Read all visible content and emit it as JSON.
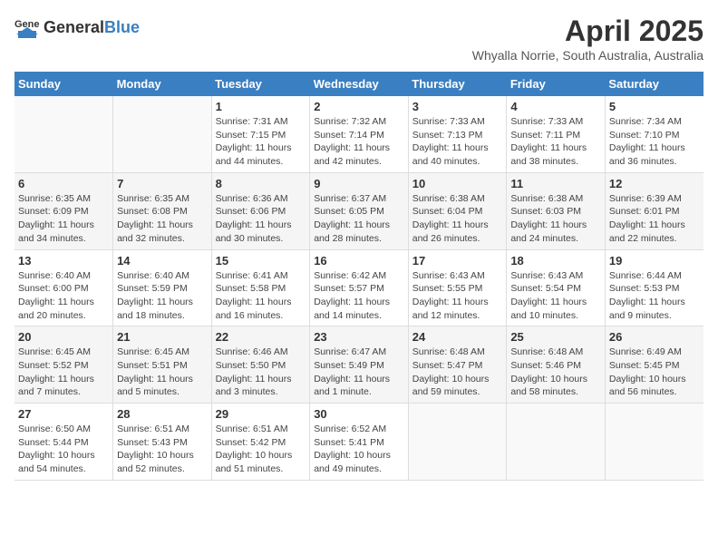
{
  "logo": {
    "text_general": "General",
    "text_blue": "Blue"
  },
  "title": "April 2025",
  "subtitle": "Whyalla Norrie, South Australia, Australia",
  "days_of_week": [
    "Sunday",
    "Monday",
    "Tuesday",
    "Wednesday",
    "Thursday",
    "Friday",
    "Saturday"
  ],
  "weeks": [
    [
      {
        "day": "",
        "sunrise": "",
        "sunset": "",
        "daylight": ""
      },
      {
        "day": "",
        "sunrise": "",
        "sunset": "",
        "daylight": ""
      },
      {
        "day": "1",
        "sunrise": "Sunrise: 7:31 AM",
        "sunset": "Sunset: 7:15 PM",
        "daylight": "Daylight: 11 hours and 44 minutes."
      },
      {
        "day": "2",
        "sunrise": "Sunrise: 7:32 AM",
        "sunset": "Sunset: 7:14 PM",
        "daylight": "Daylight: 11 hours and 42 minutes."
      },
      {
        "day": "3",
        "sunrise": "Sunrise: 7:33 AM",
        "sunset": "Sunset: 7:13 PM",
        "daylight": "Daylight: 11 hours and 40 minutes."
      },
      {
        "day": "4",
        "sunrise": "Sunrise: 7:33 AM",
        "sunset": "Sunset: 7:11 PM",
        "daylight": "Daylight: 11 hours and 38 minutes."
      },
      {
        "day": "5",
        "sunrise": "Sunrise: 7:34 AM",
        "sunset": "Sunset: 7:10 PM",
        "daylight": "Daylight: 11 hours and 36 minutes."
      }
    ],
    [
      {
        "day": "6",
        "sunrise": "Sunrise: 6:35 AM",
        "sunset": "Sunset: 6:09 PM",
        "daylight": "Daylight: 11 hours and 34 minutes."
      },
      {
        "day": "7",
        "sunrise": "Sunrise: 6:35 AM",
        "sunset": "Sunset: 6:08 PM",
        "daylight": "Daylight: 11 hours and 32 minutes."
      },
      {
        "day": "8",
        "sunrise": "Sunrise: 6:36 AM",
        "sunset": "Sunset: 6:06 PM",
        "daylight": "Daylight: 11 hours and 30 minutes."
      },
      {
        "day": "9",
        "sunrise": "Sunrise: 6:37 AM",
        "sunset": "Sunset: 6:05 PM",
        "daylight": "Daylight: 11 hours and 28 minutes."
      },
      {
        "day": "10",
        "sunrise": "Sunrise: 6:38 AM",
        "sunset": "Sunset: 6:04 PM",
        "daylight": "Daylight: 11 hours and 26 minutes."
      },
      {
        "day": "11",
        "sunrise": "Sunrise: 6:38 AM",
        "sunset": "Sunset: 6:03 PM",
        "daylight": "Daylight: 11 hours and 24 minutes."
      },
      {
        "day": "12",
        "sunrise": "Sunrise: 6:39 AM",
        "sunset": "Sunset: 6:01 PM",
        "daylight": "Daylight: 11 hours and 22 minutes."
      }
    ],
    [
      {
        "day": "13",
        "sunrise": "Sunrise: 6:40 AM",
        "sunset": "Sunset: 6:00 PM",
        "daylight": "Daylight: 11 hours and 20 minutes."
      },
      {
        "day": "14",
        "sunrise": "Sunrise: 6:40 AM",
        "sunset": "Sunset: 5:59 PM",
        "daylight": "Daylight: 11 hours and 18 minutes."
      },
      {
        "day": "15",
        "sunrise": "Sunrise: 6:41 AM",
        "sunset": "Sunset: 5:58 PM",
        "daylight": "Daylight: 11 hours and 16 minutes."
      },
      {
        "day": "16",
        "sunrise": "Sunrise: 6:42 AM",
        "sunset": "Sunset: 5:57 PM",
        "daylight": "Daylight: 11 hours and 14 minutes."
      },
      {
        "day": "17",
        "sunrise": "Sunrise: 6:43 AM",
        "sunset": "Sunset: 5:55 PM",
        "daylight": "Daylight: 11 hours and 12 minutes."
      },
      {
        "day": "18",
        "sunrise": "Sunrise: 6:43 AM",
        "sunset": "Sunset: 5:54 PM",
        "daylight": "Daylight: 11 hours and 10 minutes."
      },
      {
        "day": "19",
        "sunrise": "Sunrise: 6:44 AM",
        "sunset": "Sunset: 5:53 PM",
        "daylight": "Daylight: 11 hours and 9 minutes."
      }
    ],
    [
      {
        "day": "20",
        "sunrise": "Sunrise: 6:45 AM",
        "sunset": "Sunset: 5:52 PM",
        "daylight": "Daylight: 11 hours and 7 minutes."
      },
      {
        "day": "21",
        "sunrise": "Sunrise: 6:45 AM",
        "sunset": "Sunset: 5:51 PM",
        "daylight": "Daylight: 11 hours and 5 minutes."
      },
      {
        "day": "22",
        "sunrise": "Sunrise: 6:46 AM",
        "sunset": "Sunset: 5:50 PM",
        "daylight": "Daylight: 11 hours and 3 minutes."
      },
      {
        "day": "23",
        "sunrise": "Sunrise: 6:47 AM",
        "sunset": "Sunset: 5:49 PM",
        "daylight": "Daylight: 11 hours and 1 minute."
      },
      {
        "day": "24",
        "sunrise": "Sunrise: 6:48 AM",
        "sunset": "Sunset: 5:47 PM",
        "daylight": "Daylight: 10 hours and 59 minutes."
      },
      {
        "day": "25",
        "sunrise": "Sunrise: 6:48 AM",
        "sunset": "Sunset: 5:46 PM",
        "daylight": "Daylight: 10 hours and 58 minutes."
      },
      {
        "day": "26",
        "sunrise": "Sunrise: 6:49 AM",
        "sunset": "Sunset: 5:45 PM",
        "daylight": "Daylight: 10 hours and 56 minutes."
      }
    ],
    [
      {
        "day": "27",
        "sunrise": "Sunrise: 6:50 AM",
        "sunset": "Sunset: 5:44 PM",
        "daylight": "Daylight: 10 hours and 54 minutes."
      },
      {
        "day": "28",
        "sunrise": "Sunrise: 6:51 AM",
        "sunset": "Sunset: 5:43 PM",
        "daylight": "Daylight: 10 hours and 52 minutes."
      },
      {
        "day": "29",
        "sunrise": "Sunrise: 6:51 AM",
        "sunset": "Sunset: 5:42 PM",
        "daylight": "Daylight: 10 hours and 51 minutes."
      },
      {
        "day": "30",
        "sunrise": "Sunrise: 6:52 AM",
        "sunset": "Sunset: 5:41 PM",
        "daylight": "Daylight: 10 hours and 49 minutes."
      },
      {
        "day": "",
        "sunrise": "",
        "sunset": "",
        "daylight": ""
      },
      {
        "day": "",
        "sunrise": "",
        "sunset": "",
        "daylight": ""
      },
      {
        "day": "",
        "sunrise": "",
        "sunset": "",
        "daylight": ""
      }
    ]
  ]
}
